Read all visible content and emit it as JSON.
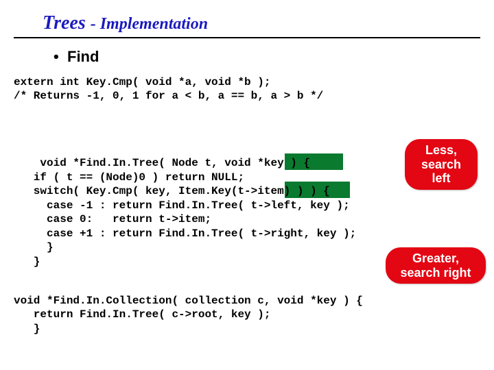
{
  "title_part1": "Trees ",
  "title_part2": "- Implementation",
  "bullet_dot": "•",
  "bullet_text": "Find",
  "code_block1": "extern int Key.Cmp( void *a, void *b );\n/* Returns -1, 0, 1 for a < b, a == b, a > b */",
  "code_block2": "void *Find.In.Tree( Node t, void *key ) {\n   if ( t == (Node)0 ) return NULL;\n   switch( Key.Cmp( key, Item.Key(t->item) ) ) {\n     case -1 : return Find.In.Tree( t->left, key );\n     case 0:   return t->item;\n     case +1 : return Find.In.Tree( t->right, key );\n     }\n   }",
  "code_block3": "void *Find.In.Collection( collection c, void *key ) {\n   return Find.In.Tree( c->root, key );\n   }",
  "callout1_line1": "Less,",
  "callout1_line2": "search",
  "callout1_line3": "left",
  "callout2_line1": "Greater,",
  "callout2_line2": "search right"
}
